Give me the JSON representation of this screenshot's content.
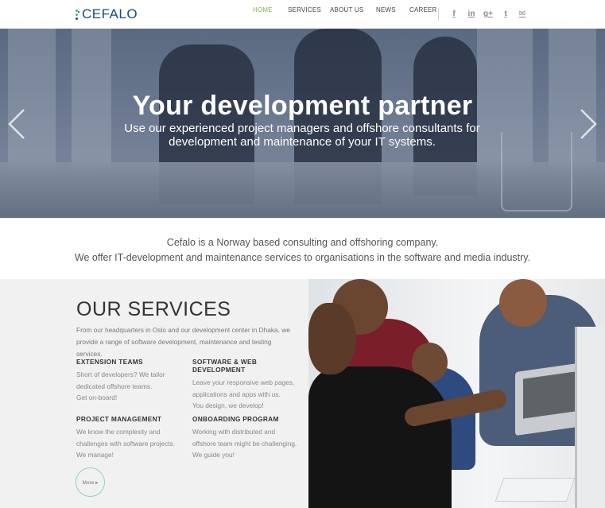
{
  "header": {
    "logo_text": "CEFALO",
    "nav": [
      {
        "label": "HOME",
        "active": true
      },
      {
        "label": "SERVICES",
        "active": false
      },
      {
        "label": "ABOUT US",
        "active": false
      },
      {
        "label": "NEWS",
        "active": false
      },
      {
        "label": "CAREER",
        "active": false
      }
    ],
    "social": [
      {
        "icon": "facebook-icon",
        "glyph": "f"
      },
      {
        "icon": "linkedin-icon",
        "glyph": "in"
      },
      {
        "icon": "google-plus-icon",
        "glyph": "g+"
      },
      {
        "icon": "twitter-icon",
        "glyph": "t"
      },
      {
        "icon": "email-icon",
        "glyph": "✉"
      }
    ]
  },
  "hero": {
    "title": "Your development partner",
    "subtitle_line1": "Use our experienced project managers and offshore consultants for",
    "subtitle_line2": "development and maintenance of your IT systems."
  },
  "intro": {
    "line1": "Cefalo is a Norway based consulting and offshoring company.",
    "line2": "We offer IT-development and maintenance services to organisations in the software and media industry."
  },
  "services": {
    "title": "OUR SERVICES",
    "desc_line1": "From our headquarters in Oslo and our development center in Dhaka, we",
    "desc_line2": "provide a range of software development, maintenance and testing services.",
    "items": [
      {
        "title": "EXTENSION TEAMS",
        "lines": [
          "Short of developers? We tailor",
          "dedicated offshore teams.",
          "Get on-board!"
        ]
      },
      {
        "title": "SOFTWARE & WEB DEVELOPMENT",
        "lines": [
          "Leave your responsive web pages,",
          "applications and apps with us.",
          "You design, we develop!"
        ]
      },
      {
        "title": "PROJECT MANAGEMENT",
        "lines": [
          "We know the complexity and",
          "challenges with software projects.",
          "We manage!"
        ]
      },
      {
        "title": "ONBOARDING PROGRAM",
        "lines": [
          "Working with distributed and",
          "offshore team might be challenging.",
          "We guide you!"
        ]
      }
    ],
    "more_label": "More ▸"
  },
  "colors": {
    "accent_green": "#7ab648",
    "logo_blue": "#1c4a80",
    "logo_dot_green": "#3fb38a",
    "logo_dot_blue": "#1c4a80",
    "more_border": "#8fd4b0"
  }
}
